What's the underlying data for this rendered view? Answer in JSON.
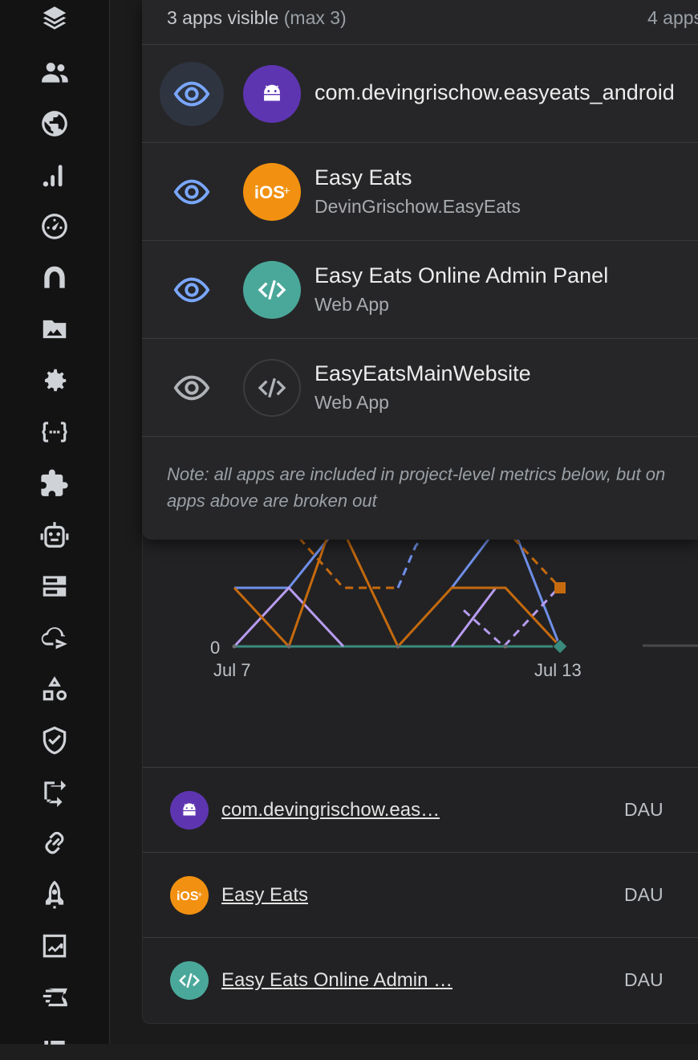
{
  "sidebar": {
    "items": [
      {
        "icon": "stacked-layers-icon"
      },
      {
        "icon": "people-icon"
      },
      {
        "icon": "globe-icon"
      },
      {
        "icon": "signal-bars-icon"
      },
      {
        "icon": "speedometer-icon"
      },
      {
        "icon": "app-check-icon"
      },
      {
        "icon": "folder-image-icon"
      },
      {
        "icon": "settings-gear-icon"
      },
      {
        "icon": "code-brackets-icon"
      },
      {
        "icon": "extensions-puzzle-icon"
      },
      {
        "icon": "robot-icon"
      },
      {
        "icon": "database-icon"
      },
      {
        "icon": "cloud-send-icon"
      },
      {
        "icon": "shapes-icon"
      },
      {
        "icon": "shield-check-icon"
      },
      {
        "icon": "route-icon"
      },
      {
        "icon": "link-icon"
      },
      {
        "icon": "rocket-icon"
      },
      {
        "icon": "chart-trend-icon"
      },
      {
        "icon": "ticket-icon"
      }
    ]
  },
  "popup": {
    "visible_count": "3 apps visible",
    "visible_max": "(max 3)",
    "total": "4 apps",
    "apps": [
      {
        "title": "com.devingrischow.easyeats_android",
        "subtitle": "",
        "platform": "android",
        "visible": true,
        "color": "#5e35b1"
      },
      {
        "title": "Easy Eats",
        "subtitle": "DevinGrischow.EasyEats",
        "platform": "ios",
        "visible": true,
        "color": "#f29111"
      },
      {
        "title": "Easy Eats Online Admin Panel",
        "subtitle": "Web App",
        "platform": "web",
        "visible": true,
        "color": "#4aa89a"
      },
      {
        "title": "EasyEatsMainWebsite",
        "subtitle": "Web App",
        "platform": "web",
        "visible": false,
        "color": "#262628"
      }
    ],
    "note_line1": "Note: all apps are included in project-level metrics below, but on",
    "note_line2": "apps above are broken out"
  },
  "chart_data": {
    "type": "line",
    "x_start": "Jul 7",
    "x_end": "Jul 13",
    "y_zero": "0",
    "colors": {
      "blue": "#6f8fe8",
      "orange": "#c56a0e",
      "lilac": "#b89cf0",
      "teal": "#3a8a7e"
    }
  },
  "table": {
    "rows": [
      {
        "name": "com.devingrischow.eas…",
        "metric": "DAU",
        "platform": "android",
        "color": "#5e35b1"
      },
      {
        "name": "Easy Eats",
        "metric": "DAU",
        "platform": "ios",
        "color": "#f29111"
      },
      {
        "name": "Easy Eats Online Admin …",
        "metric": "DAU",
        "platform": "web",
        "color": "#4aa89a"
      }
    ]
  }
}
